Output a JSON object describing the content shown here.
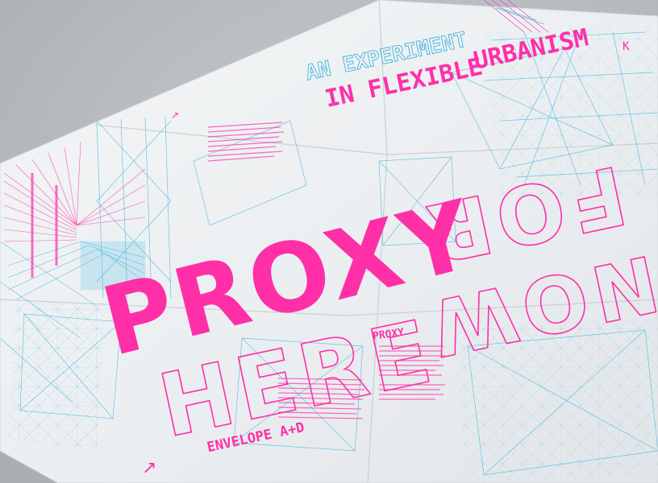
{
  "poster": {
    "headline_line1": "AN EXPERIMENT",
    "headline_line2": "IN FLEXIBLE",
    "headline_line3": "URBANISM",
    "big_word_1": "PROXY",
    "big_word_2": "HERE",
    "big_word_3": "FOR",
    "big_word_4": "NOW",
    "section_title": "PROXY",
    "credit": "ENVELOPE A+D",
    "arrow_glyph": "↗",
    "corner_glyph": "K"
  },
  "colors": {
    "magenta": "#ff2fa8",
    "cyan": "#3fb4e0",
    "paper": "#eceff1",
    "background": "#b9bcbf"
  }
}
